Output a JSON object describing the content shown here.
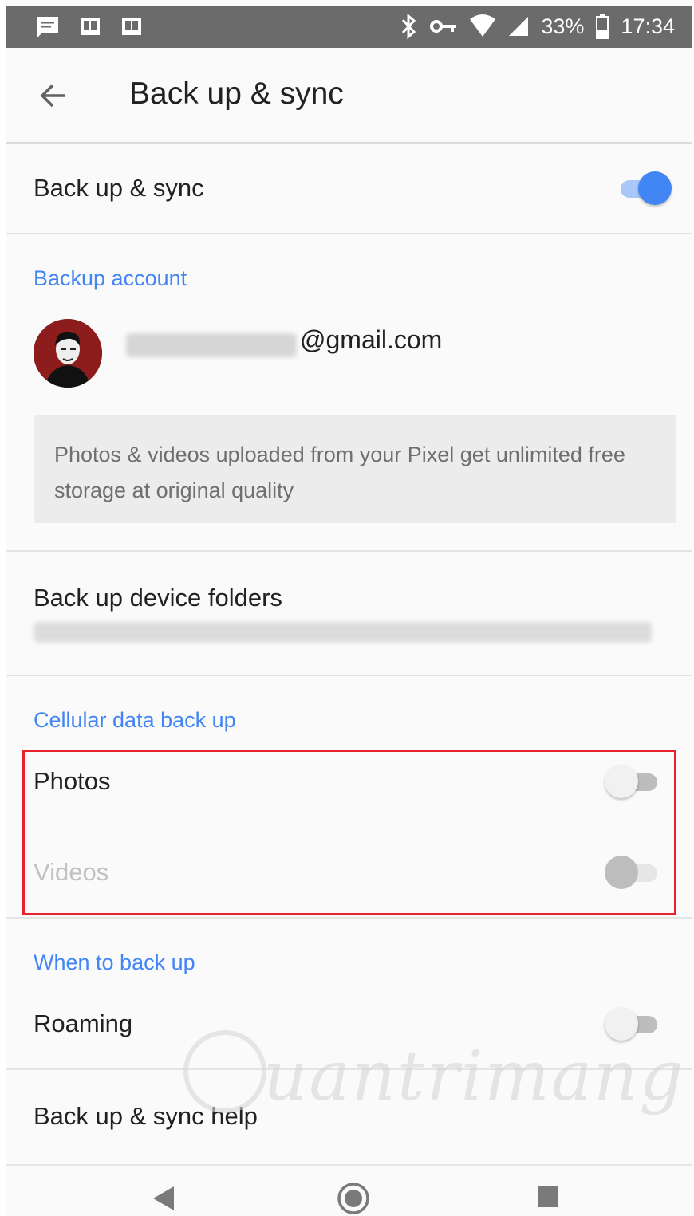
{
  "status_bar": {
    "battery": "33%",
    "time": "17:34",
    "left_icons": [
      "message-icon",
      "book-icon",
      "book-icon"
    ],
    "right_icons": [
      "bluetooth-icon",
      "vpn-key-icon",
      "wifi-icon",
      "signal-icon",
      "battery-icon"
    ]
  },
  "app_bar": {
    "title": "Back up & sync",
    "back_icon": "arrow-left-icon"
  },
  "main_toggle": {
    "label": "Back up & sync",
    "state": "on"
  },
  "backup_account": {
    "header": "Backup account",
    "email_suffix": "@gmail.com",
    "info": "Photos & videos uploaded from your Pixel get unlimited free storage at original quality"
  },
  "device_folders": {
    "label": "Back up device folders"
  },
  "cellular": {
    "header": "Cellular data back up",
    "photos_label": "Photos",
    "photos_state": "off",
    "videos_label": "Videos",
    "videos_state": "disabled"
  },
  "when": {
    "header": "When to back up",
    "roaming_label": "Roaming",
    "roaming_state": "off"
  },
  "help": {
    "label": "Back up & sync help"
  },
  "watermark": "uantrimang",
  "colors": {
    "accent": "#4285f4",
    "highlight": "#e8222a",
    "status_bar": "#6b6b6b"
  }
}
